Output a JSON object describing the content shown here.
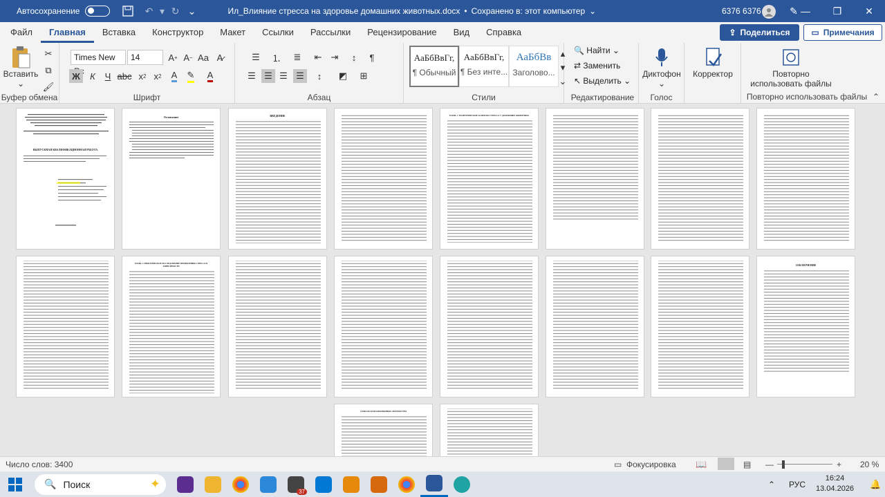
{
  "window": {
    "autosave_label": "Автосохранение",
    "title": "Ил_Влияние стресса на здоровье домашних животных.docx",
    "save_status": "Сохранено в: этот компьютер",
    "user_name": "6376 6376"
  },
  "menu": [
    "Файл",
    "Главная",
    "Вставка",
    "Конструктор",
    "Макет",
    "Ссылки",
    "Рассылки",
    "Рецензирование",
    "Вид",
    "Справка"
  ],
  "menu_active": "Главная",
  "share_label": "Поделиться",
  "comments_label": "Примечания",
  "ribbon": {
    "clipboard": {
      "paste_label": "Вставить",
      "group_label": "Буфер обмена"
    },
    "font": {
      "family": "Times New Rc",
      "size": "14",
      "group_label": "Шрифт"
    },
    "paragraph": {
      "group_label": "Абзац"
    },
    "styles": {
      "group_label": "Стили",
      "items": [
        {
          "preview": "АаБбВвГг,",
          "name": "¶ Обычный"
        },
        {
          "preview": "АаБбВвГг,",
          "name": "¶ Без инте..."
        },
        {
          "preview": "АаБбВв",
          "name": "Заголово..."
        }
      ]
    },
    "editing": {
      "find": "Найти",
      "replace": "Заменить",
      "select": "Выделить",
      "group_label": "Редактирование"
    },
    "voice": {
      "dictate": "Диктофон",
      "group_label": "Голос"
    },
    "editor": {
      "label": "Корректор"
    },
    "reuse": {
      "label": "Повторно использовать файлы",
      "group_label": "Повторно использовать файлы"
    }
  },
  "status": {
    "word_count": "Число слов: 3400",
    "focus": "Фокусировка",
    "zoom": "20 %"
  },
  "taskbar": {
    "search": "Поиск",
    "lang": "РУС",
    "time": "16:24",
    "date": "13.04.2026",
    "badge": "37"
  },
  "pages": {
    "cover_title": "ВЫПУСКНАЯ КВАЛИФИКАЦИОННАЯ РАБОТА",
    "p2_title": "Оглавление",
    "p3_title": "ВВЕДЕНИЕ",
    "p5_title": "ГЛАВА 1. ТЕОРЕТИЧЕСКИЕ АСПЕКТЫ СТРЕССА У ДОМАШНИХ ЖИВОТНЫХ",
    "p10_title": "ГЛАВА 2. ПРАКТИЧЕСКОЕ ИССЛЕДОВАНИЕ ПРОЯВЛЕНИЯ СТРЕССА В ЗАВИСИМОСТИ",
    "p16_title": "ЗАКЛЮЧЕНИЕ",
    "p17_title": "СПИСОК ИСПОЛЬЗОВАННЫХ ЛИТЕРАТУРЫ"
  }
}
